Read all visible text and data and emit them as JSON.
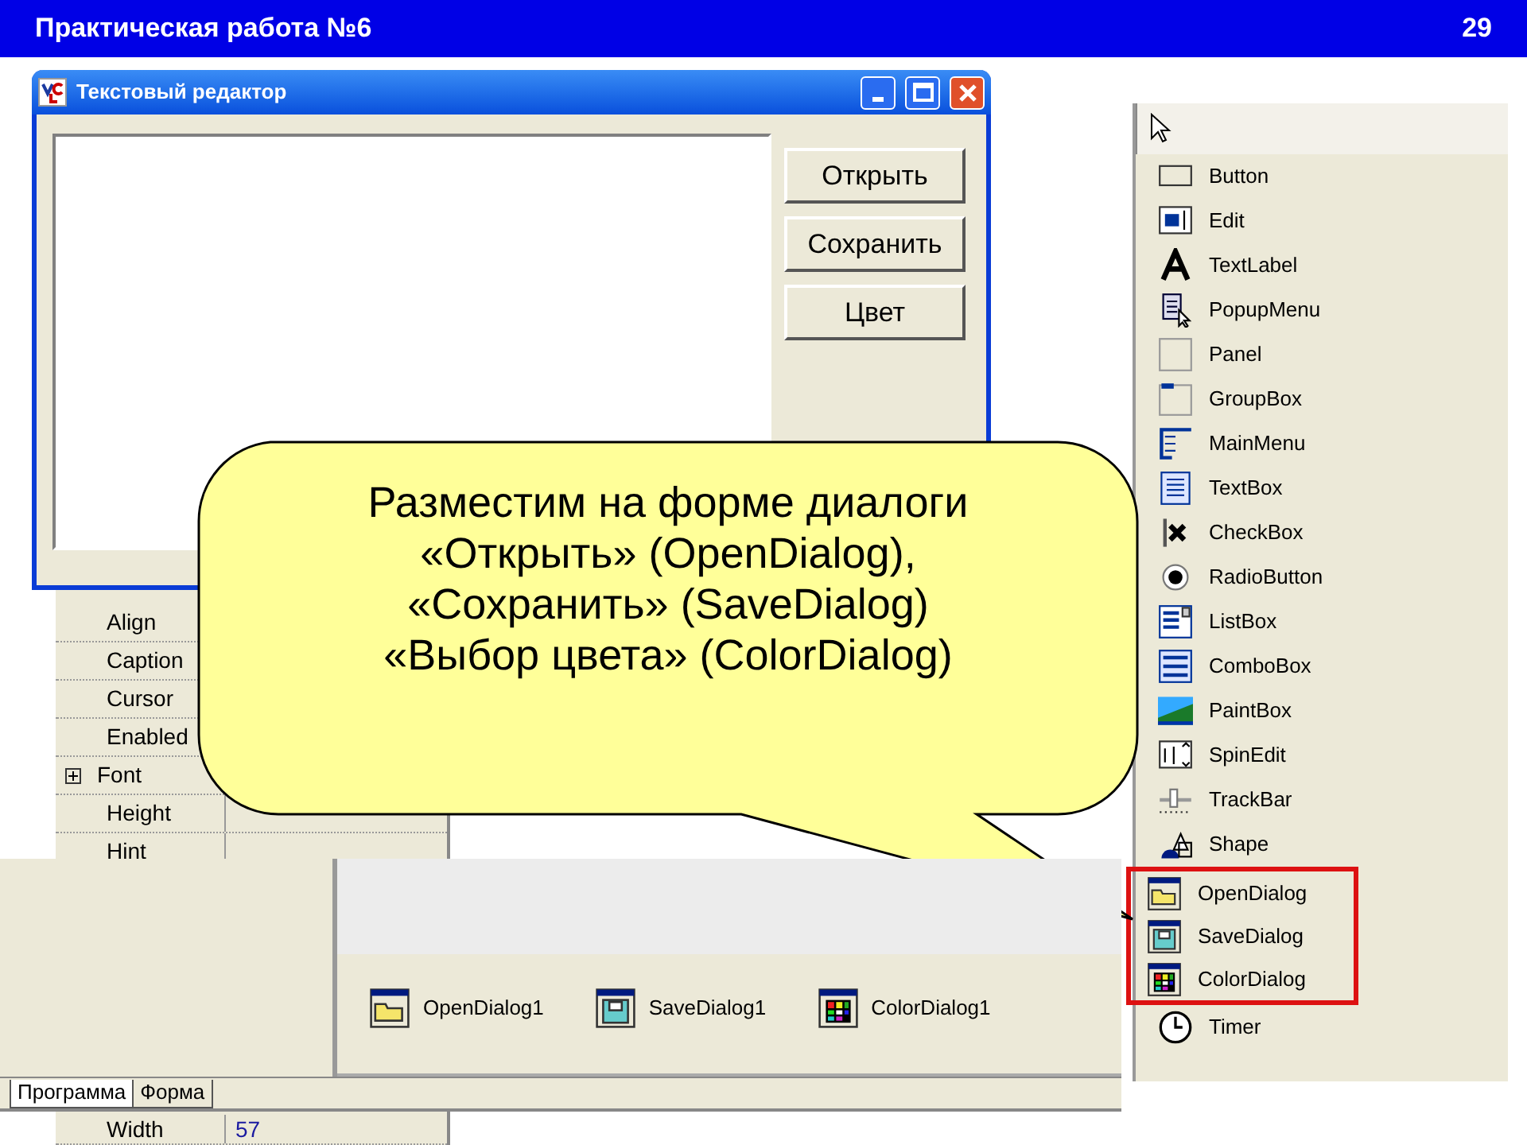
{
  "header": {
    "title": "Практическая работа №6",
    "page": "29"
  },
  "form_window": {
    "title": "Текстовый редактор",
    "buttons": [
      "Открыть",
      "Сохранить",
      "Цвет"
    ]
  },
  "properties": {
    "rows": [
      {
        "name": "Align"
      },
      {
        "name": "Caption"
      },
      {
        "name": "Cursor"
      },
      {
        "name": "Enabled"
      },
      {
        "name": "Font",
        "expandable": true
      },
      {
        "name": "Height"
      },
      {
        "name": "Hint"
      }
    ],
    "bottom_rows": [
      {
        "name": "Width",
        "value": "57"
      }
    ]
  },
  "designer": {
    "components": [
      {
        "label": "OpenDialog1",
        "kind": "open"
      },
      {
        "label": "SaveDialog1",
        "kind": "save"
      },
      {
        "label": "ColorDialog1",
        "kind": "color"
      }
    ],
    "tabs": [
      {
        "label": "Программа",
        "selected": true
      },
      {
        "label": "Форма",
        "selected": false
      }
    ]
  },
  "palette": {
    "items": [
      {
        "label": "Button",
        "kind": "button",
        "highlighted": false
      },
      {
        "label": "Edit",
        "kind": "edit",
        "highlighted": false
      },
      {
        "label": "TextLabel",
        "kind": "label",
        "highlighted": false
      },
      {
        "label": "PopupMenu",
        "kind": "popup",
        "highlighted": false
      },
      {
        "label": "Panel",
        "kind": "panel",
        "highlighted": false
      },
      {
        "label": "GroupBox",
        "kind": "group",
        "highlighted": false
      },
      {
        "label": "MainMenu",
        "kind": "menu",
        "highlighted": false
      },
      {
        "label": "TextBox",
        "kind": "textbox",
        "highlighted": false
      },
      {
        "label": "CheckBox",
        "kind": "check",
        "highlighted": false
      },
      {
        "label": "RadioButton",
        "kind": "radio",
        "highlighted": false
      },
      {
        "label": "ListBox",
        "kind": "list",
        "highlighted": false
      },
      {
        "label": "ComboBox",
        "kind": "combo",
        "highlighted": false
      },
      {
        "label": "PaintBox",
        "kind": "paint",
        "highlighted": false
      },
      {
        "label": "SpinEdit",
        "kind": "spin",
        "highlighted": false
      },
      {
        "label": "TrackBar",
        "kind": "track",
        "highlighted": false
      },
      {
        "label": "Shape",
        "kind": "shape",
        "highlighted": false
      },
      {
        "label": "OpenDialog",
        "kind": "open",
        "highlighted": true
      },
      {
        "label": "SaveDialog",
        "kind": "save",
        "highlighted": true
      },
      {
        "label": "ColorDialog",
        "kind": "color",
        "highlighted": true
      },
      {
        "label": "Timer",
        "kind": "timer",
        "highlighted": false
      }
    ]
  },
  "callout": {
    "lines": [
      "Разместим на форме диалоги",
      "«Открыть» (OpenDialog),",
      "«Сохранить» (SaveDialog)",
      "«Выбор цвета» (ColorDialog)"
    ]
  }
}
